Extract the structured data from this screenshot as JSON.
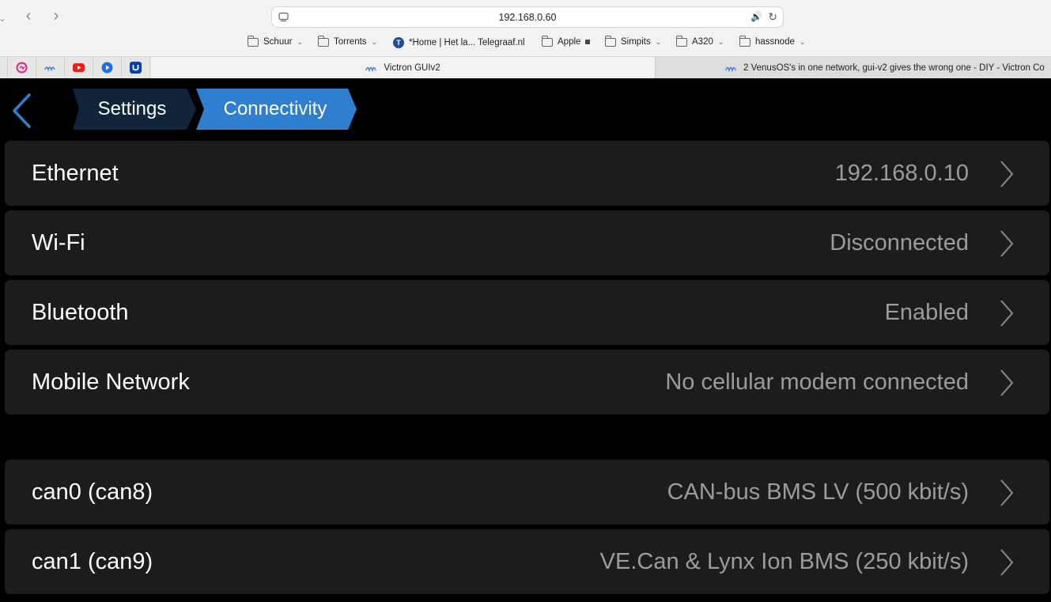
{
  "browser": {
    "url": "192.168.0.60",
    "bookmarks": [
      {
        "label": "Schuur",
        "icon": "folder-icon",
        "has_caret": true
      },
      {
        "label": "Torrents",
        "icon": "folder-icon",
        "has_caret": true
      },
      {
        "label": "*Home | Het la... Telegraaf.nl",
        "icon": "telegraaf-icon",
        "has_caret": false
      },
      {
        "label": "Apple",
        "icon": "folder-icon",
        "has_caret": false
      },
      {
        "label": "Simpits",
        "icon": "folder-icon",
        "has_caret": true
      },
      {
        "label": "A320",
        "icon": "folder-icon",
        "has_caret": true
      },
      {
        "label": "hassnode",
        "icon": "folder-icon",
        "has_caret": true
      }
    ],
    "tabs": [
      {
        "title": "Victron GUIv2",
        "active": true
      },
      {
        "title": "2 VenusOS's in one network, gui-v2 gives the wrong one - DIY - Victron Co",
        "active": false
      }
    ]
  },
  "breadcrumb": {
    "items": [
      "Settings",
      "Connectivity"
    ],
    "colors": {
      "inactive": "#11253a",
      "active": "#2f7fd0"
    }
  },
  "settings_list": [
    {
      "label": "Ethernet",
      "value": "192.168.0.10"
    },
    {
      "label": "Wi-Fi",
      "value": "Disconnected"
    },
    {
      "label": "Bluetooth",
      "value": "Enabled"
    },
    {
      "label": "Mobile Network",
      "value": "No cellular modem connected"
    }
  ],
  "can_list": [
    {
      "label": "can0 (can8)",
      "value": "CAN-bus BMS LV (500 kbit/s)"
    },
    {
      "label": "can1 (can9)",
      "value": "VE.Can & Lynx Ion BMS (250 kbit/s)"
    }
  ],
  "colors": {
    "accent": "#2f7fd0",
    "row_bg": "#1c1c1c",
    "value_text": "#9c9c9c"
  }
}
